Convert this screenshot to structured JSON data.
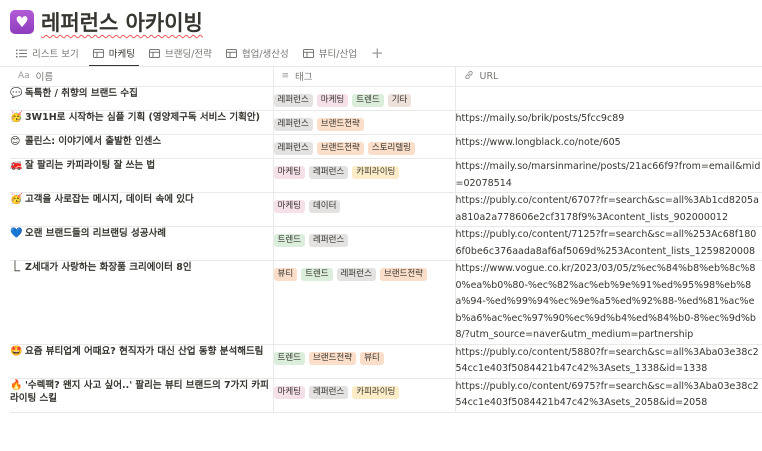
{
  "page": {
    "title": "레퍼런스 아카이빙",
    "icon": "heart-emoji-icon"
  },
  "tabs": [
    {
      "label": "리스트 보기",
      "icon": "list-icon",
      "active": false
    },
    {
      "label": "마케팅",
      "icon": "table-icon",
      "active": true
    },
    {
      "label": "브랜딩/전략",
      "icon": "table-icon",
      "active": false
    },
    {
      "label": "협업/생산성",
      "icon": "table-icon",
      "active": false
    },
    {
      "label": "뷰티/산업",
      "icon": "table-icon",
      "active": false
    }
  ],
  "add_view": "+",
  "columns": {
    "name": {
      "label": "이름",
      "icon": "Aa"
    },
    "tags": {
      "label": "태그",
      "icon": "≡"
    },
    "url": {
      "label": "URL",
      "icon": "link-icon"
    }
  },
  "tag_colors": {
    "레퍼런스": "gray",
    "마케팅": "pink",
    "트렌드": "green",
    "기타": "brown",
    "브랜드전략": "orange",
    "스토리텔링": "orange",
    "카피라이팅": "yellow",
    "데이터": "gray",
    "뷰티": "orange"
  },
  "rows": [
    {
      "emoji": "💬",
      "name": "독특한 / 취향의 브랜드 수집",
      "tags": [
        "레퍼런스",
        "마케팅",
        "트렌드",
        "기타"
      ],
      "url": ""
    },
    {
      "emoji": "🥳",
      "name": "3W1H로 시작하는 심플 기획 (영양제구독 서비스 기획안)",
      "tags": [
        "레퍼런스",
        "브랜드전략"
      ],
      "url": "https://maily.so/brik/posts/5fcc9c89"
    },
    {
      "emoji": "😊",
      "name": "콜린스: 이야기에서 출발한 인센스",
      "tags": [
        "레퍼런스",
        "브랜드전략",
        "스토리텔링"
      ],
      "url": "https://www.longblack.co/note/605"
    },
    {
      "emoji": "🚒",
      "name": "잘 팔리는 카피라이팅 잘 쓰는 법",
      "tags": [
        "마케팅",
        "레퍼런스",
        "카피라이팅"
      ],
      "url": "https://maily.so/marsinmarine/posts/21ac66f9?from=email&mid=02078514"
    },
    {
      "emoji": "🥳",
      "name": "고객을 사로잡는 메시지, 데이터 속에 있다",
      "tags": [
        "마케팅",
        "데이터"
      ],
      "url": "https://publy.co/content/6707?fr=search&sc=all%3Ab1cd8205aa810a2a778606e2cf3178f9%3Acontent_lists_902000012"
    },
    {
      "emoji": "💙",
      "name": "오랜 브랜드들의 리브랜딩 성공사례",
      "tags": [
        "트렌드",
        "레퍼런스"
      ],
      "url": "https://publy.co/content/7125?fr=search&sc=all%253Ac68f1806f0be6c376aada8af6af5069d%253Acontent_lists_1259820008"
    },
    {
      "emoji": "⎿",
      "name": "Z세대가 사랑하는 화장품 크리에이터 8인",
      "tags": [
        "뷰티",
        "트렌드",
        "레퍼런스",
        "브랜드전략"
      ],
      "url": "https://www.vogue.co.kr/2023/03/05/z%ec%84%b8%eb%8c%80%ea%b0%80-%ec%82%ac%eb%9e%91%ed%95%98%eb%8a%94-%ed%99%94%ec%9e%a5%ed%92%88-%ed%81%ac%eb%a6%ac%ec%97%90%ec%9d%b4%ed%84%b0-8%ec%9d%b8/?utm_source=naver&utm_medium=partnership"
    },
    {
      "emoji": "🤩",
      "name": "요즘 뷰티업계 어때요? 현직자가 대신 산업 동향 분석해드림",
      "tags": [
        "트렌드",
        "브랜드전략",
        "뷰티"
      ],
      "url": "https://publy.co/content/5880?fr=search&sc=all%3Aba03e38c254cc1e403f5084421b47c42%3Asets_1338&id=1338"
    },
    {
      "emoji": "🔥",
      "name": "'수렉팩? 왠지 사고 싶어..' 팔리는 뷰티 브랜드의 7가지 카피라이팅 스킬",
      "tags": [
        "마케팅",
        "레퍼런스",
        "카피라이팅"
      ],
      "url": "https://publy.co/content/6975?fr=search&sc=all%3Aba03e38c254cc1e403f5084421b47c42%3Asets_2058&id=2058"
    }
  ]
}
